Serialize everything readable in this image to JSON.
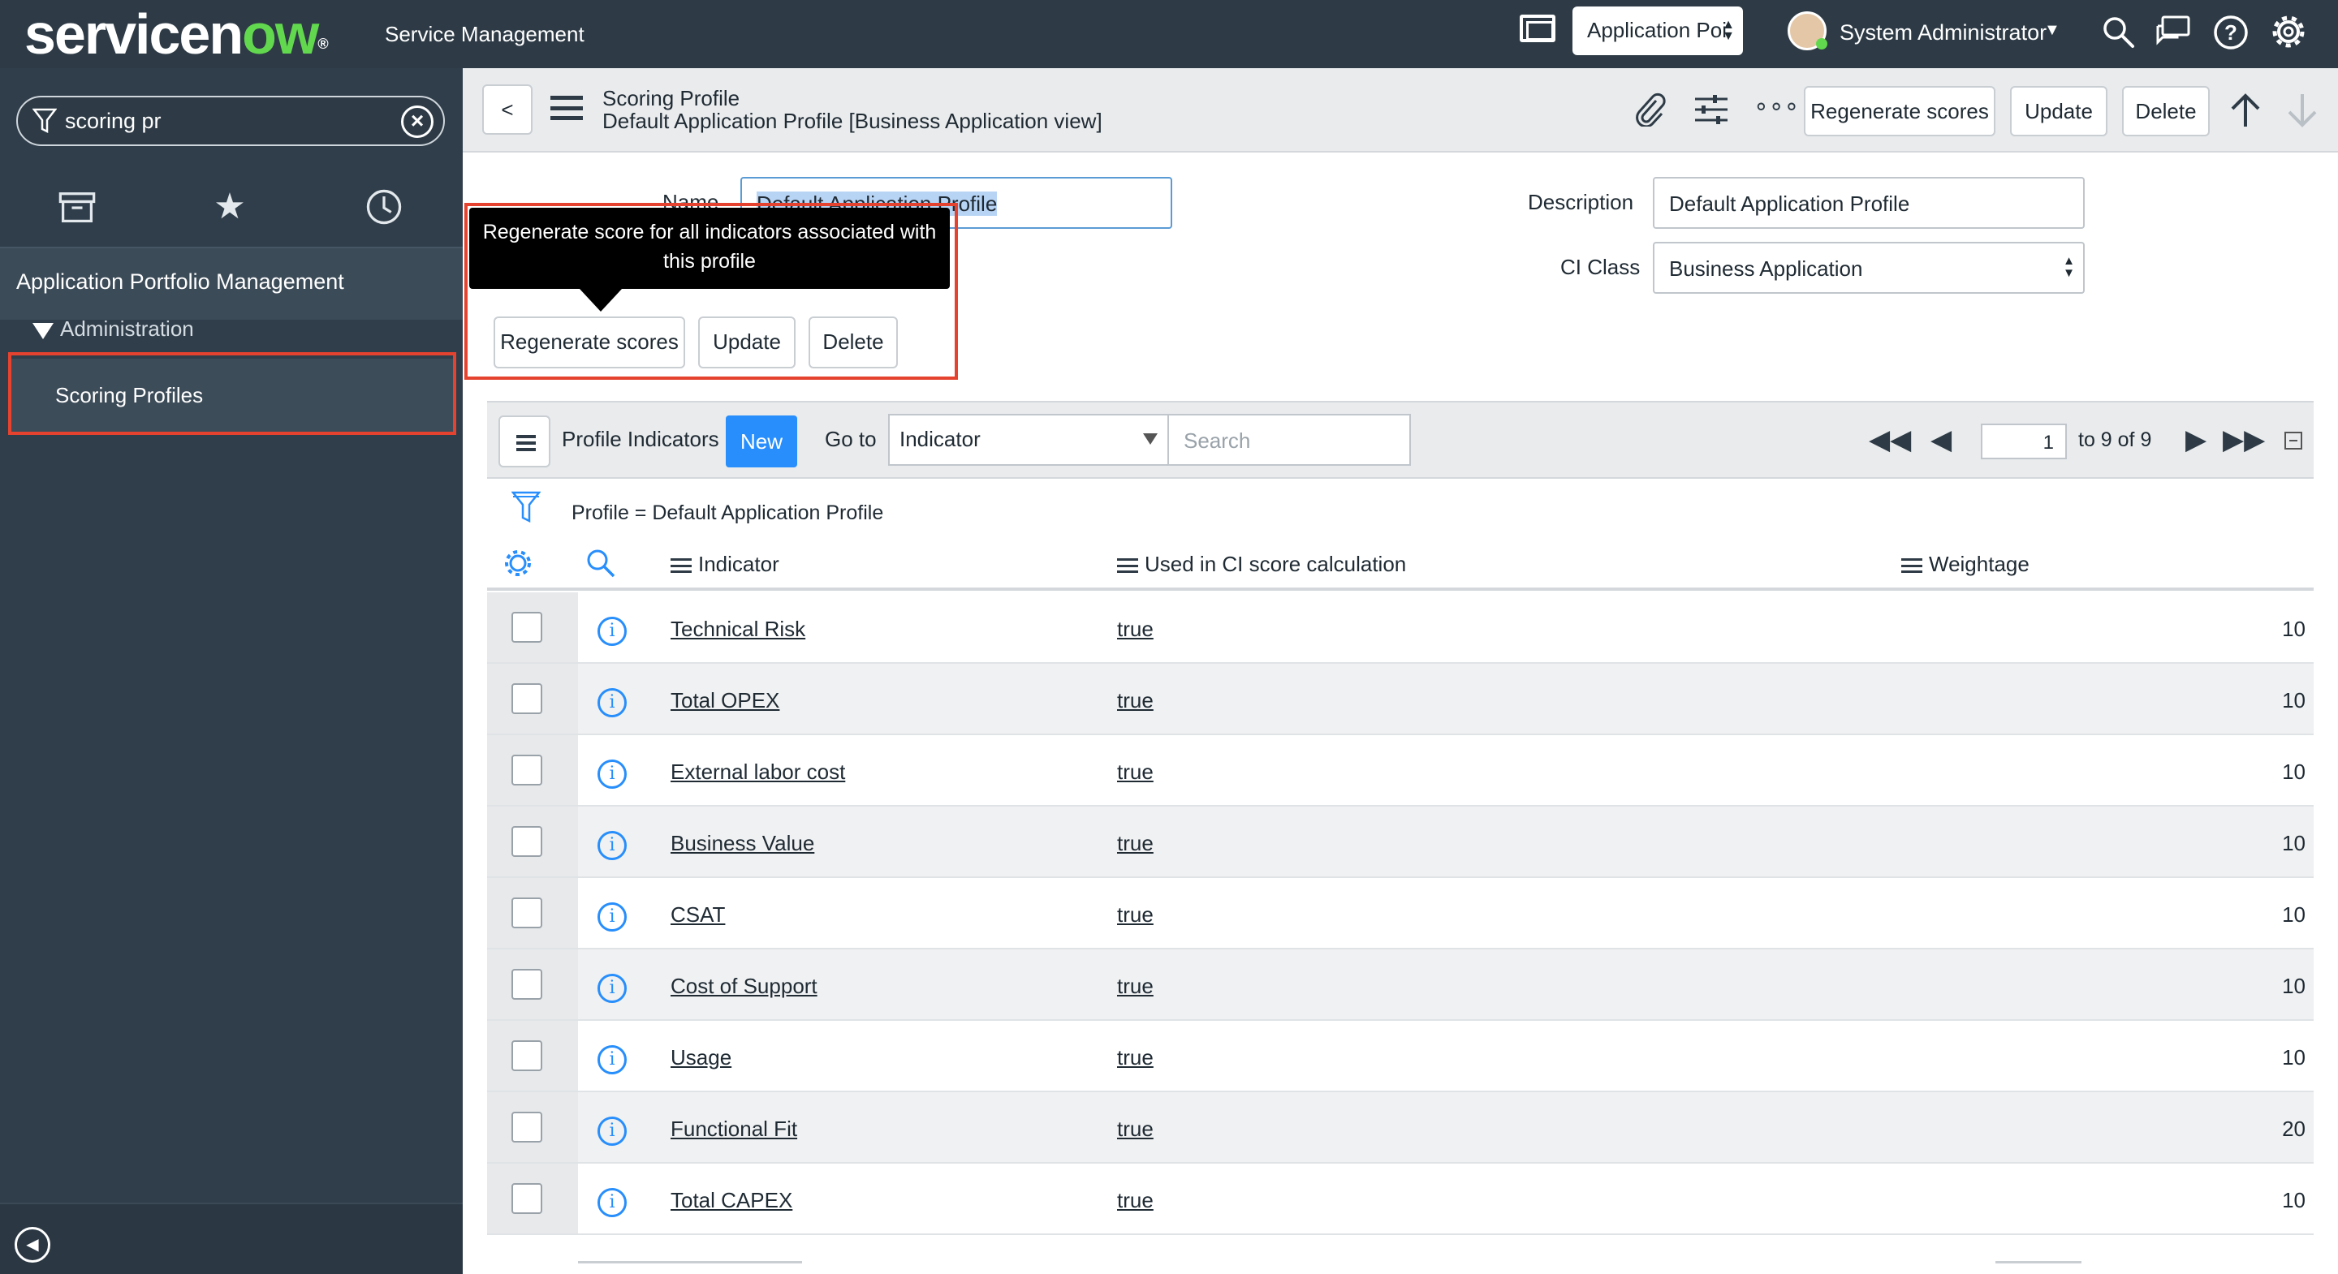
{
  "header": {
    "logo_main": "servicen",
    "logo_ow": "ow",
    "product": "Service Management",
    "app_picker": "Application Poi",
    "user": "System Administrator"
  },
  "nav": {
    "filter_value": "scoring pr",
    "section": "Application Portfolio Management",
    "group": "Administration",
    "item": "Scoring Profiles"
  },
  "form": {
    "title": "Scoring Profile",
    "subtitle": "Default Application Profile [Business Application view]",
    "buttons": {
      "regenerate": "Regenerate scores",
      "update": "Update",
      "delete": "Delete"
    },
    "name_label": "Name",
    "name_value": "Default Application Profile",
    "description_label": "Description",
    "description_value": "Default Application Profile",
    "ci_class_label": "CI Class",
    "ci_class_value": "Business Application",
    "tooltip": "Regenerate score for all indicators associated with this profile"
  },
  "related_list": {
    "title": "Profile Indicators",
    "new_label": "New",
    "goto_label": "Go to",
    "goto_field": "Indicator",
    "search_placeholder": "Search",
    "page_value": "1",
    "page_range": "to 9 of 9",
    "filter_text": "Profile = Default Application Profile",
    "columns": [
      "Indicator",
      "Used in CI score calculation",
      "Weightage"
    ],
    "rows": [
      {
        "indicator": "Technical Risk",
        "used": "true",
        "weight": "10"
      },
      {
        "indicator": "Total OPEX",
        "used": "true",
        "weight": "10"
      },
      {
        "indicator": "External labor cost",
        "used": "true",
        "weight": "10"
      },
      {
        "indicator": "Business Value",
        "used": "true",
        "weight": "10"
      },
      {
        "indicator": "CSAT",
        "used": "true",
        "weight": "10"
      },
      {
        "indicator": "Cost of Support",
        "used": "true",
        "weight": "10"
      },
      {
        "indicator": "Usage",
        "used": "true",
        "weight": "10"
      },
      {
        "indicator": "Functional Fit",
        "used": "true",
        "weight": "20"
      },
      {
        "indicator": "Total CAPEX",
        "used": "true",
        "weight": "10"
      }
    ]
  },
  "colors": {
    "header_bg": "#2e3b46",
    "nav_bg": "#303e4b",
    "accent": "#278efc",
    "highlight": "#e5432f",
    "logo_green": "#62d84e"
  },
  "icons": [
    "screen-icon",
    "search-icon",
    "chat-icon",
    "help-icon",
    "gear-icon",
    "archive-icon",
    "star-icon",
    "history-icon",
    "paperclip-icon",
    "sliders-icon",
    "more-icon",
    "arrow-up-icon",
    "arrow-down-icon",
    "filter-icon",
    "info-icon"
  ]
}
